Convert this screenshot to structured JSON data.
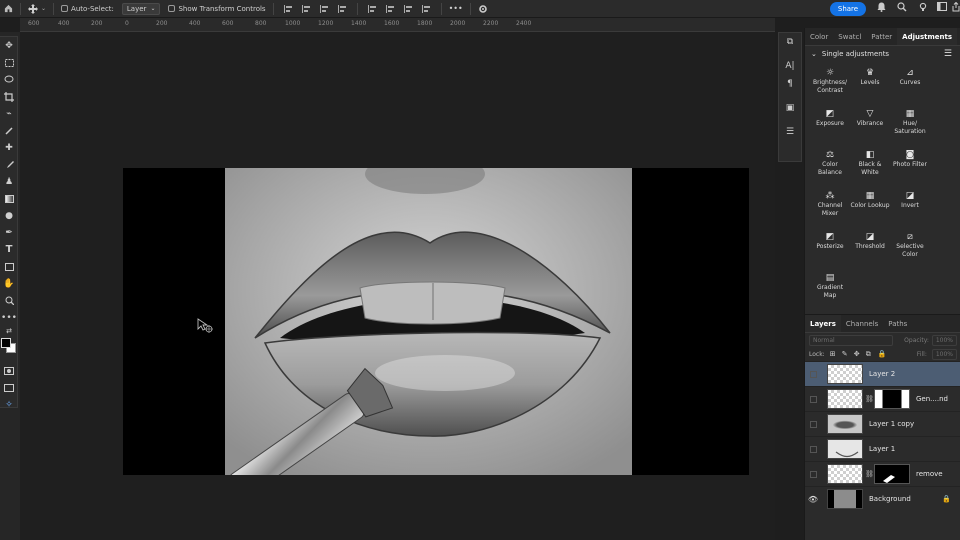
{
  "options_bar": {
    "auto_select_label": "Auto-Select:",
    "auto_select_value": "Layer",
    "transform_label": "Show Transform Controls",
    "more_label": "•••",
    "share_label": "Share"
  },
  "ruler": {
    "labels": [
      "600",
      "400",
      "200",
      "0",
      "200",
      "400",
      "600",
      "800",
      "1000",
      "1200",
      "1400",
      "1600",
      "1800",
      "2000",
      "2200",
      "2400"
    ]
  },
  "adjustments": {
    "tabs": [
      "Color",
      "Swatcl",
      "Patter",
      "Adjustments"
    ],
    "section_title": "Single adjustments",
    "items": [
      {
        "label": "Brightness/ Contrast",
        "icon": "sun-icon"
      },
      {
        "label": "Levels",
        "icon": "levels-icon"
      },
      {
        "label": "Curves",
        "icon": "curves-icon"
      },
      {
        "label": "Exposure",
        "icon": "exposure-icon"
      },
      {
        "label": "Vibrance",
        "icon": "vibrance-icon"
      },
      {
        "label": "Hue/ Saturation",
        "icon": "hue-icon"
      },
      {
        "label": "Color Balance",
        "icon": "balance-icon"
      },
      {
        "label": "Black & White",
        "icon": "bw-icon"
      },
      {
        "label": "Photo Filter",
        "icon": "camera-icon"
      },
      {
        "label": "Channel Mixer",
        "icon": "mixer-icon"
      },
      {
        "label": "Color Lookup",
        "icon": "grid-icon"
      },
      {
        "label": "Invert",
        "icon": "invert-icon"
      },
      {
        "label": "Posterize",
        "icon": "posterize-icon"
      },
      {
        "label": "Threshold",
        "icon": "threshold-icon"
      },
      {
        "label": "Selective Color",
        "icon": "selective-icon"
      },
      {
        "label": "Gradient Map",
        "icon": "gradient-icon"
      }
    ]
  },
  "layers_panel": {
    "tabs": [
      "Layers",
      "Channels",
      "Paths"
    ],
    "blend_mode": "Normal",
    "opacity_label": "Opacity:",
    "opacity_value": "100%",
    "lock_label": "Lock:",
    "fill_label": "Fill:",
    "fill_value": "100%",
    "layers": [
      {
        "name": "Layer 2",
        "selected": true,
        "visible": false,
        "has_mask": false
      },
      {
        "name": "Gen....nd",
        "selected": false,
        "visible": false,
        "has_mask": true
      },
      {
        "name": "Layer 1 copy",
        "selected": false,
        "visible": false,
        "has_mask": false
      },
      {
        "name": "Layer 1",
        "selected": false,
        "visible": false,
        "has_mask": false
      },
      {
        "name": "remove",
        "selected": false,
        "visible": false,
        "has_mask": true
      },
      {
        "name": "Background",
        "selected": false,
        "visible": true,
        "has_mask": false,
        "locked": true
      }
    ]
  },
  "colors": {
    "accent": "#1473e6",
    "selected_layer": "#4c5d73",
    "panel_bg": "#2b2b2b",
    "canvas_bg": "#1f1f1f"
  }
}
